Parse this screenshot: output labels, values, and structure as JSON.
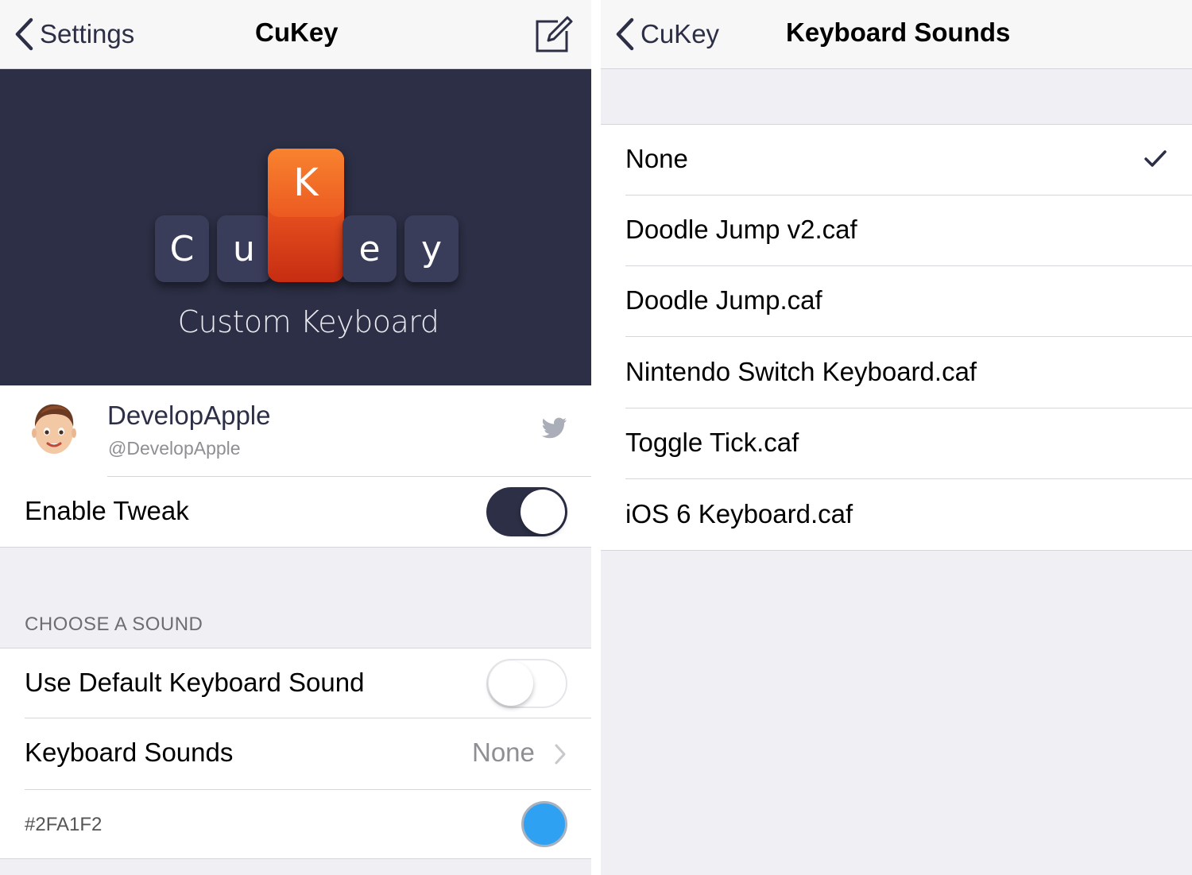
{
  "left": {
    "nav": {
      "back_label": "Settings",
      "title": "CuKey"
    },
    "banner": {
      "keys": [
        "C",
        "u",
        "K",
        "e",
        "y"
      ],
      "subtitle": "Custom Keyboard"
    },
    "profile": {
      "name": "DevelopApple",
      "handle": "@DevelopApple"
    },
    "enable_tweak": {
      "label": "Enable Tweak",
      "on": true
    },
    "section_header": "CHOOSE A SOUND",
    "use_default": {
      "label": "Use Default Keyboard Sound",
      "on": false
    },
    "keyboard_sounds": {
      "label": "Keyboard Sounds",
      "value": "None"
    },
    "color_row": {
      "label": "#2FA1F2",
      "color": "#2FA1F2"
    }
  },
  "right": {
    "nav": {
      "back_label": "CuKey",
      "title": "Keyboard Sounds"
    },
    "options": [
      {
        "label": "None",
        "selected": true
      },
      {
        "label": "Doodle Jump v2.caf",
        "selected": false
      },
      {
        "label": "Doodle Jump.caf",
        "selected": false
      },
      {
        "label": "Nintendo Switch Keyboard.caf",
        "selected": false
      },
      {
        "label": "Toggle Tick.caf",
        "selected": false
      },
      {
        "label": "iOS 6 Keyboard.caf",
        "selected": false
      }
    ]
  },
  "colors": {
    "accent": "#2C2F45",
    "banner_bg": "#2C2F45",
    "key_orange": "#EC5A21",
    "swatch": "#2FA1F2"
  }
}
